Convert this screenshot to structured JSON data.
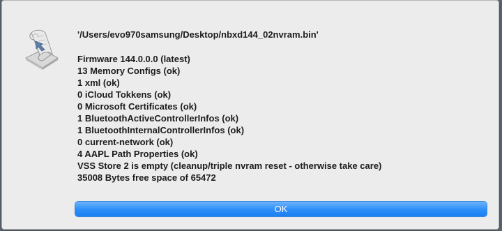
{
  "dialog": {
    "icon": "script-editor-icon",
    "file_path": "'/Users/evo970samsung/Desktop/nbxd144_02nvram.bin'",
    "lines": [
      "Firmware 144.0.0.0 (latest)",
      "13 Memory Configs (ok)",
      "1 xml (ok)",
      "0 iCloud Tokkens (ok)",
      "0 Microsoft Certificates (ok)",
      "1 BluetoothActiveControllerInfos (ok)",
      "1 BluetoothInternalControllerInfos (ok)",
      "0 current-network (ok)",
      "4 AAPL Path Properties (ok)",
      "VSS Store 2 is empty (cleanup/triple nvram reset - otherwise take care)",
      "35008 Bytes free space of 65472"
    ],
    "ok_label": "OK"
  },
  "colors": {
    "dialog_background": "#ececec",
    "button_blue": "#2d8ef8",
    "desktop": "#5b6572"
  }
}
